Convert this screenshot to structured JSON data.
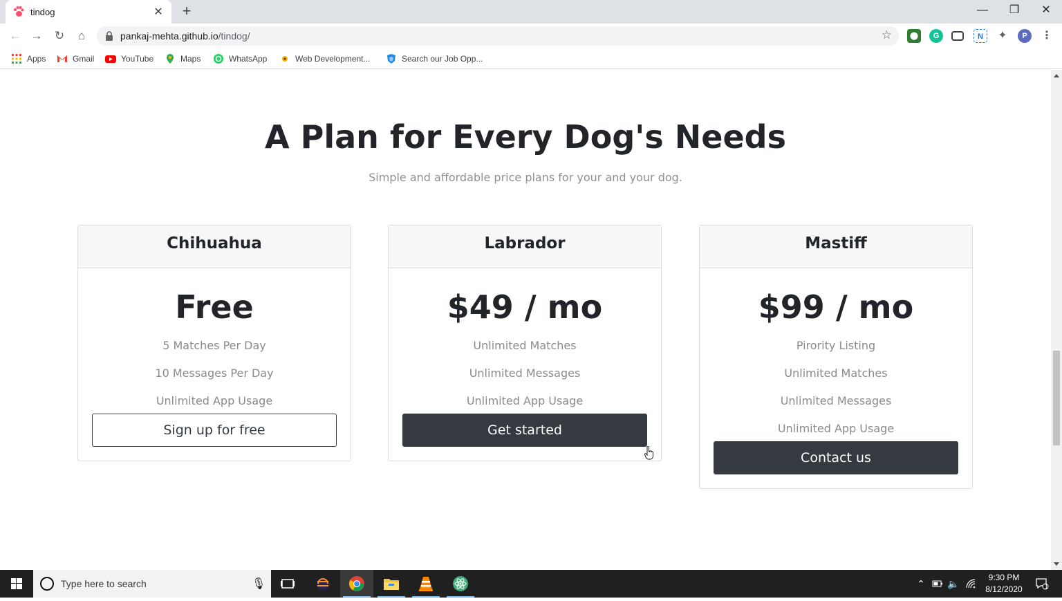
{
  "browser": {
    "tab_title": "tindog",
    "tab_close": "✕",
    "new_tab": "+",
    "url_host": "pankaj-mehta.github.io",
    "url_path": "/tindog/",
    "window_controls": {
      "minimize": "—",
      "maximize": "❐",
      "close": "✕"
    },
    "extension_n": "N",
    "profile_initial": "P"
  },
  "bookmarks": [
    {
      "label": "Apps",
      "icon": "apps-grid-icon"
    },
    {
      "label": "Gmail",
      "icon": "gmail-icon"
    },
    {
      "label": "YouTube",
      "icon": "youtube-icon"
    },
    {
      "label": "Maps",
      "icon": "maps-pin-icon"
    },
    {
      "label": "WhatsApp",
      "icon": "whatsapp-icon"
    },
    {
      "label": "Web Development...",
      "icon": "web-dev-icon"
    },
    {
      "label": "Search our Job Opp...",
      "icon": "job-search-icon"
    }
  ],
  "pricing": {
    "title": "A Plan for Every Dog's Needs",
    "subtitle": "Simple and affordable price plans for your and your dog.",
    "plans": [
      {
        "name": "Chihuahua",
        "price": "Free",
        "features": [
          "5 Matches Per Day",
          "10 Messages Per Day",
          "Unlimited App Usage"
        ],
        "button": "Sign up for free",
        "button_style": "outline"
      },
      {
        "name": "Labrador",
        "price": "$49 / mo",
        "features": [
          "Unlimited Matches",
          "Unlimited Messages",
          "Unlimited App Usage"
        ],
        "button": "Get started",
        "button_style": "dark"
      },
      {
        "name": "Mastiff",
        "price": "$99 / mo",
        "features": [
          "Pirority Listing",
          "Unlimited Matches",
          "Unlimited Messages",
          "Unlimited App Usage"
        ],
        "button": "Contact us",
        "button_style": "dark"
      }
    ]
  },
  "taskbar": {
    "search_placeholder": "Type here to search",
    "time": "9:30 PM",
    "date": "8/12/2020",
    "notification_count": "1"
  },
  "colors": {
    "heading": "#212529",
    "muted": "#8a8a8a",
    "dark_button": "#343a40",
    "card_header_bg": "#f7f7f7"
  }
}
